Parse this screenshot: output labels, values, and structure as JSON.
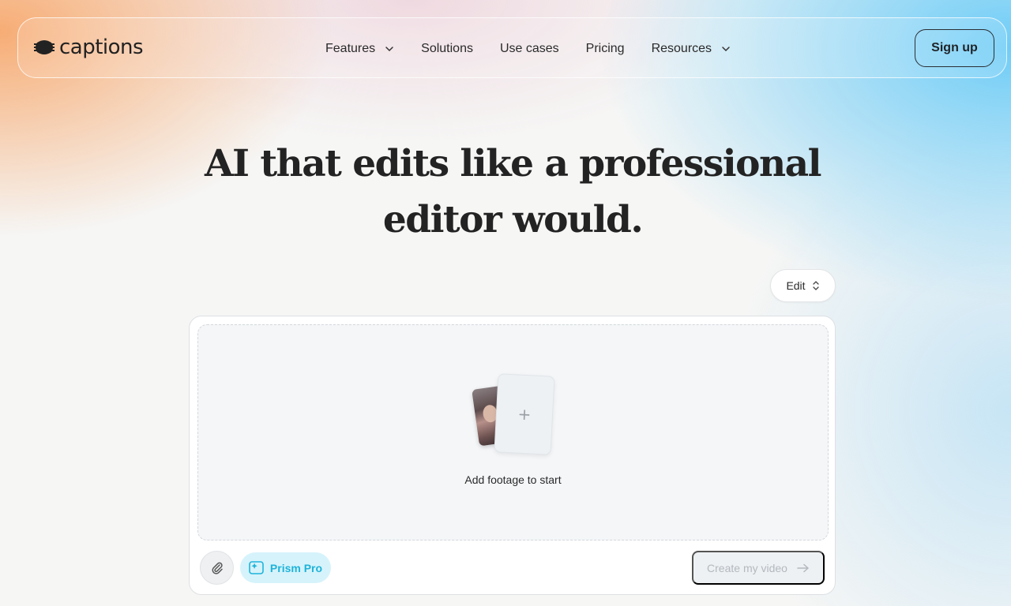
{
  "brand": {
    "name": "captions"
  },
  "nav": {
    "items": [
      {
        "label": "Features",
        "has_dropdown": true
      },
      {
        "label": "Solutions",
        "has_dropdown": false
      },
      {
        "label": "Use cases",
        "has_dropdown": false
      },
      {
        "label": "Pricing",
        "has_dropdown": false
      },
      {
        "label": "Resources",
        "has_dropdown": true
      }
    ],
    "signup_label": "Sign up"
  },
  "hero": {
    "title_line1": "AI that edits like a professional",
    "title_line2": "editor would."
  },
  "mode_select": {
    "selected": "Edit"
  },
  "composer": {
    "dropzone_label": "Add footage to start",
    "model_label": "Prism Pro",
    "submit_label": "Create my video",
    "submit_enabled": false
  },
  "colors": {
    "accent_cyan": "#1fb3d9",
    "accent_cyan_bg": "#d6f3fb",
    "text_dark": "#232323"
  },
  "icons": {
    "logo": "captions-logo-icon",
    "attach": "paperclip-icon",
    "model": "prism-icon",
    "submit": "arrow-right-icon",
    "dropdown": "chevron-down-icon",
    "select": "chevron-up-down-icon",
    "add": "plus-icon"
  }
}
